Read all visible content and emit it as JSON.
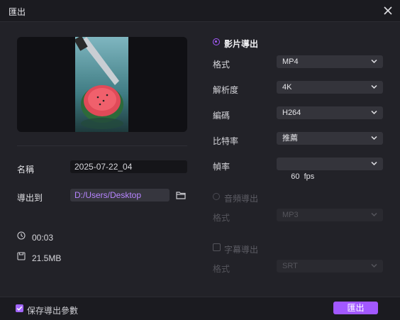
{
  "title": "匯出",
  "left": {
    "name_label": "名稱",
    "name_value": "2025-07-22_04",
    "export_to_label": "導出到",
    "export_path": "D:/Users/Desktop",
    "duration": "00:03",
    "size": "21.5MB"
  },
  "video": {
    "section_label": "影片導出",
    "rows": [
      {
        "label": "格式",
        "value": "MP4"
      },
      {
        "label": "解析度",
        "value": "4K"
      },
      {
        "label": "編碼",
        "value": "H264"
      },
      {
        "label": "比特率",
        "value": "推薦"
      },
      {
        "label": "幀率",
        "value": "60  fps"
      }
    ]
  },
  "audio": {
    "section_label": "音頻導出",
    "format_label": "格式",
    "format_value": "MP3"
  },
  "subtitle": {
    "section_label": "字幕導出",
    "format_label": "格式",
    "format_value": "SRT"
  },
  "footer": {
    "save_params_label": "保存導出參數",
    "export_button": "匯出"
  },
  "colors": {
    "accent": "#a258ff",
    "background": "#222228"
  },
  "icons": [
    "close-icon",
    "folder-icon",
    "clock-icon",
    "file-size-icon",
    "chevron-down-icon",
    "checkbox-checked-icon"
  ]
}
